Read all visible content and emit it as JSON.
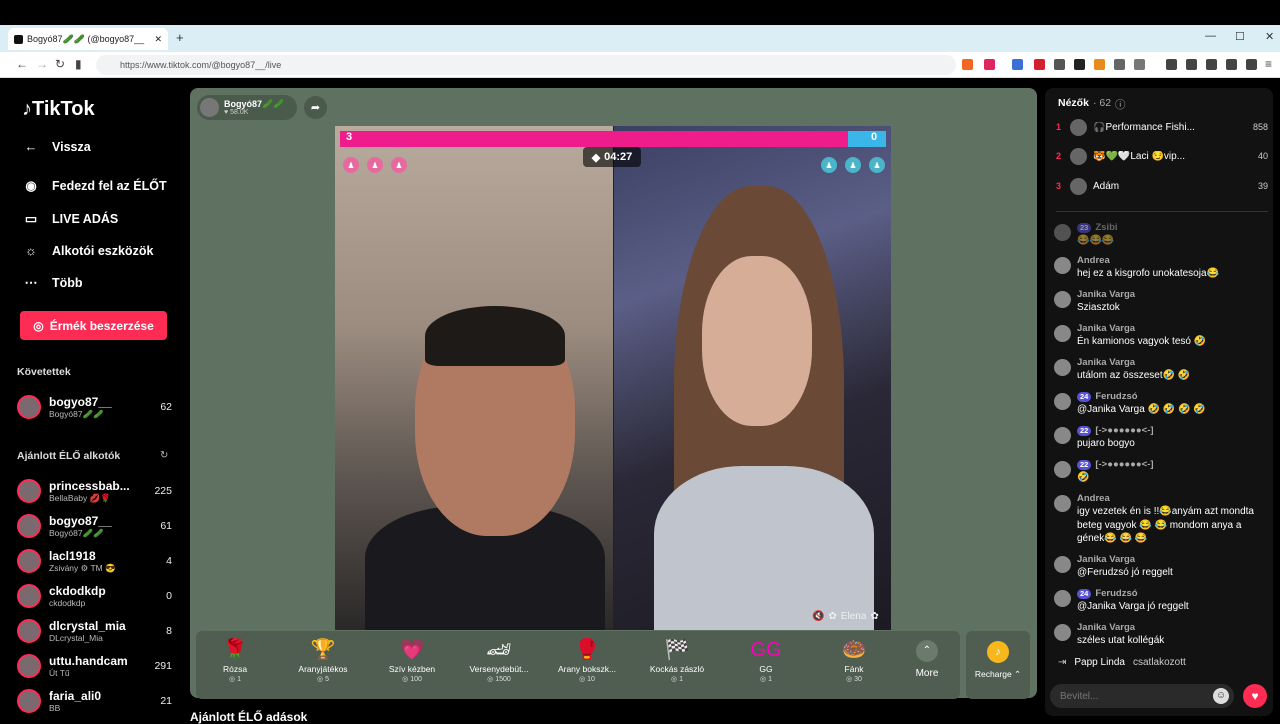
{
  "browser": {
    "tab_title": "Bogyó87🥒🥒 (@bogyo87__",
    "url": "https://www.tiktok.com/@bogyo87__/live",
    "new_tab": "+",
    "minimize": "—",
    "maximize": "☐",
    "close": "✕"
  },
  "logo": "TikTok",
  "nav": {
    "back": "Vissza",
    "explore": "Fedezd fel az ÉLŐT",
    "live": "LIVE ADÁS",
    "tools": "Alkotói eszközök",
    "more": "Több"
  },
  "coins_button": "Érmék beszerzése",
  "following": {
    "title": "Követettek",
    "accounts": [
      {
        "name": "bogyo87__",
        "sub": "Bogyó87🥒🥒",
        "count": "62"
      }
    ]
  },
  "recommended": {
    "title": "Ajánlott ÉLŐ alkotók",
    "accounts": [
      {
        "name": "princessbab...",
        "sub": "BellaBaby 💋🌹",
        "count": "225"
      },
      {
        "name": "bogyo87__",
        "sub": "Bogyó87🥒🥒",
        "count": "61"
      },
      {
        "name": "lacl1918",
        "sub": "Zsivány ⚙ TM 😎",
        "count": "4"
      },
      {
        "name": "ckdodkdp",
        "sub": "ckdodkdp",
        "count": "0"
      },
      {
        "name": "dlcrystal_mia",
        "sub": "DLcrystal_Mia",
        "count": "8"
      },
      {
        "name": "uttu.handcam",
        "sub": "Út Tű",
        "count": "291"
      },
      {
        "name": "faria_ali0",
        "sub": "BB",
        "count": "21"
      }
    ]
  },
  "host": {
    "name": "Bogyó87🥒🥒",
    "likes": "♥ 58.0K"
  },
  "battle": {
    "left_score": "3",
    "right_score": "0",
    "left_fraction": 0.93,
    "timer": "04:27",
    "opponent": "Elena"
  },
  "gifts": [
    {
      "icon": "🌹",
      "name": "Rózsa",
      "price": "1"
    },
    {
      "icon": "🏆",
      "name": "Aranyjátékos",
      "price": "5"
    },
    {
      "icon": "💗",
      "name": "Szív kézben",
      "price": "100"
    },
    {
      "icon": "🏎",
      "name": "Versenydebüt...",
      "price": "1500"
    },
    {
      "icon": "🥊",
      "name": "Arany bokszk...",
      "price": "10"
    },
    {
      "icon": "🏁",
      "name": "Kockás zászló",
      "price": "1"
    },
    {
      "icon": "GG",
      "name": "GG",
      "price": "1"
    },
    {
      "icon": "🍩",
      "name": "Fánk",
      "price": "30"
    }
  ],
  "more_label": "More",
  "recharge_label": "Recharge ⌃",
  "below_title": "Ajánlott ÉLŐ adások",
  "viewers": {
    "title": "Nézők",
    "count": "· 62",
    "list": [
      {
        "rank": "1",
        "name": "🎧Performance Fishi...",
        "score": "858"
      },
      {
        "rank": "2",
        "name": "🐯💚🤍Laci 😏vip...",
        "score": "40"
      },
      {
        "rank": "3",
        "name": "Ádám",
        "score": "39"
      }
    ]
  },
  "comments": [
    {
      "user": "Zsibi",
      "badge": "23",
      "text": "😂😂😂"
    },
    {
      "user": "Andrea",
      "badge": "",
      "text": "hej ez a kisgrofo unokatesoja😂"
    },
    {
      "user": "Janika Varga",
      "badge": "",
      "text": "Sziasztok"
    },
    {
      "user": "Janika Varga",
      "badge": "",
      "text": "Én kamionos vagyok tesó 🤣"
    },
    {
      "user": "Janika Varga",
      "badge": "",
      "text": "utálom az összeset🤣 🤣"
    },
    {
      "user": "Ferudzsó",
      "badge": "24",
      "text": "@Janika Varga 🤣 🤣 🤣 🤣"
    },
    {
      "user": "[->●●●●●●<-]",
      "badge": "22",
      "text": "pujaro bogyo"
    },
    {
      "user": "[->●●●●●●<-]",
      "badge": "22",
      "text": "🤣"
    },
    {
      "user": "Andrea",
      "badge": "",
      "text": "igy vezetek én is !!😂anyám azt mondta beteg vagyok 😂 😂 mondom anya a gének😂 😂 😂"
    },
    {
      "user": "Janika Varga",
      "badge": "",
      "text": "@Ferudzsó jó reggelt"
    },
    {
      "user": "Ferudzsó",
      "badge": "24",
      "text": "@Janika Varga jó reggelt"
    },
    {
      "user": "Janika Varga",
      "badge": "",
      "text": "széles utat kollégák"
    }
  ],
  "joined": {
    "user": "Papp Linda",
    "text": "csatlakozott"
  },
  "input_placeholder": "Bevitel..."
}
